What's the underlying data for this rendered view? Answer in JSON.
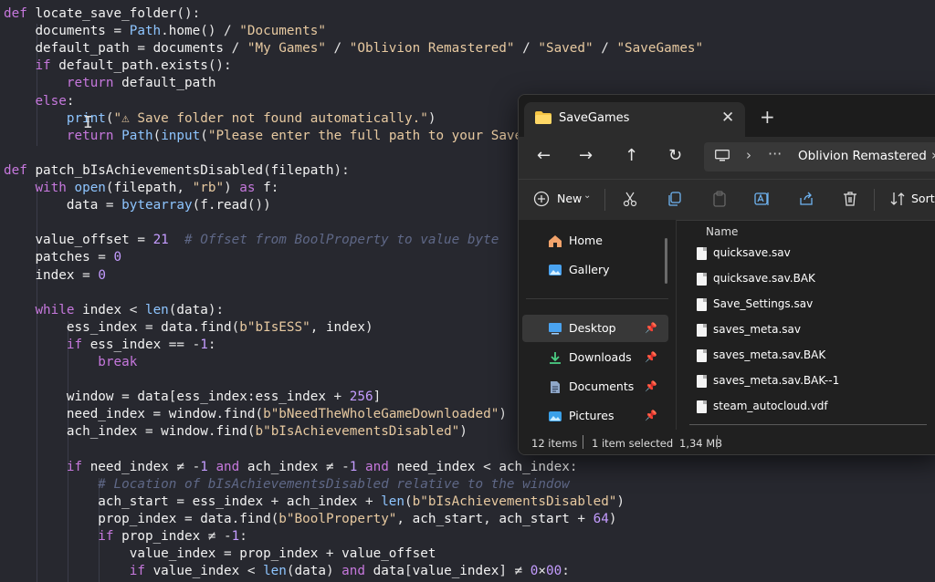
{
  "editor": {
    "lines": [
      "def locate_save_folder():",
      "    documents = Path.home() / \"Documents\"",
      "    default_path = documents / \"My Games\" / \"Oblivion Remastered\" / \"Saved\" / \"SaveGames\"",
      "    if default_path.exists():",
      "        return default_path",
      "    else:",
      "        print(\"⚠ Save folder not found automatically.\")",
      "        return Path(input(\"Please enter the full path to your Save",
      "",
      "def patch_bIsAchievementsDisabled(filepath):",
      "    with open(filepath, \"rb\") as f:",
      "        data = bytearray(f.read())",
      "",
      "    value_offset = 21  # Offset from BoolProperty to value byte",
      "    patches = 0",
      "    index = 0",
      "",
      "    while index < len(data):",
      "        ess_index = data.find(b\"bIsESS\", index)",
      "        if ess_index == -1:",
      "            break",
      "",
      "        window = data[ess_index:ess_index + 256]",
      "        need_index = window.find(b\"bNeedTheWholeGameDownloaded\")",
      "        ach_index = window.find(b\"bIsAchievementsDisabled\")",
      "",
      "        if need_index ≠ -1 and ach_index ≠ -1 and need_index < ach_index:",
      "            # Location of bIsAchievementsDisabled relative to the window",
      "            ach_start = ess_index + ach_index + len(b\"bIsAchievementsDisabled\")",
      "            prop_index = data.find(b\"BoolProperty\", ach_start, ach_start + 64)",
      "            if prop_index ≠ -1:",
      "                value_index = prop_index + value_offset",
      "                if value_index < len(data) and data[value_index] ≠ 0×00:"
    ]
  },
  "explorer": {
    "tab_title": "SaveGames",
    "tab_close": "✕",
    "new_tab": "+",
    "nav": {
      "back": "←",
      "forward": "→",
      "up": "↑",
      "refresh": "↻"
    },
    "address": {
      "ellipsis": "···",
      "crumb": "Oblivion Remastered",
      "sep": "›"
    },
    "toolbar": {
      "new_label": "New",
      "sort_label": "Sort"
    },
    "sidebar": [
      {
        "label": "Home",
        "icon": "home-icon",
        "pinned": false
      },
      {
        "label": "Gallery",
        "icon": "gallery-icon",
        "pinned": false
      },
      {
        "label": "Desktop",
        "icon": "desktop-icon",
        "pinned": true,
        "selected": true
      },
      {
        "label": "Downloads",
        "icon": "downloads-icon",
        "pinned": true
      },
      {
        "label": "Documents",
        "icon": "documents-icon",
        "pinned": true
      },
      {
        "label": "Pictures",
        "icon": "pictures-icon",
        "pinned": true
      }
    ],
    "column_name": "Name",
    "files": [
      "quicksave.sav",
      "quicksave.sav.BAK",
      "Save_Settings.sav",
      "saves_meta.sav",
      "saves_meta.sav.BAK",
      "saves_meta.sav.BAK--1",
      "steam_autocloud.vdf"
    ],
    "status": {
      "items": "12 items",
      "selected": "1 item selected",
      "size": "1,34 MB"
    },
    "colors": {
      "folder": "#f6c544",
      "accent": "#4aa3f0"
    }
  }
}
